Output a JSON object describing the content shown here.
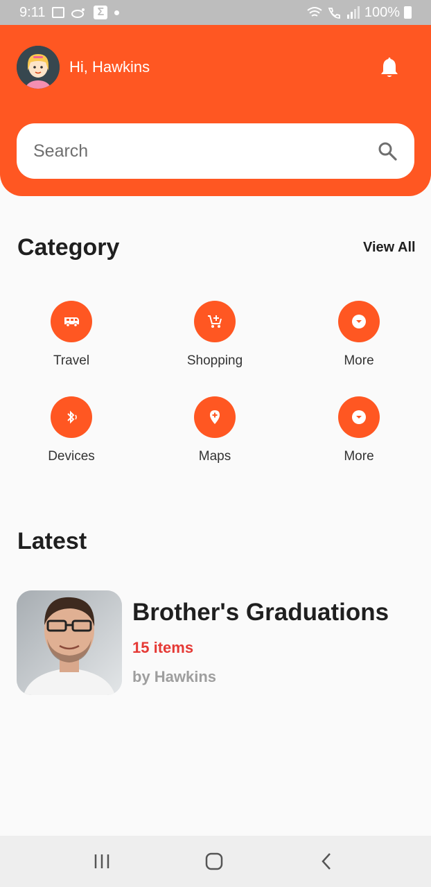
{
  "status_bar": {
    "time": "9:11",
    "battery": "100%"
  },
  "header": {
    "greeting": "Hi, Hawkins",
    "search_placeholder": "Search"
  },
  "category": {
    "title": "Category",
    "view_all": "View All",
    "items": [
      {
        "label": "Travel",
        "icon": "bus-icon"
      },
      {
        "label": "Shopping",
        "icon": "cart-icon"
      },
      {
        "label": "More",
        "icon": "chevron-down-icon"
      },
      {
        "label": "Devices",
        "icon": "bluetooth-icon"
      },
      {
        "label": "Maps",
        "icon": "location-pin-icon"
      },
      {
        "label": "More",
        "icon": "chevron-down-icon"
      }
    ]
  },
  "latest": {
    "title": "Latest",
    "card": {
      "title": "Brother's Graduations",
      "count": "15 items",
      "author": "by Hawkins"
    }
  },
  "colors": {
    "primary": "#ff5722",
    "count": "#e53935",
    "muted": "#9e9e9e"
  }
}
